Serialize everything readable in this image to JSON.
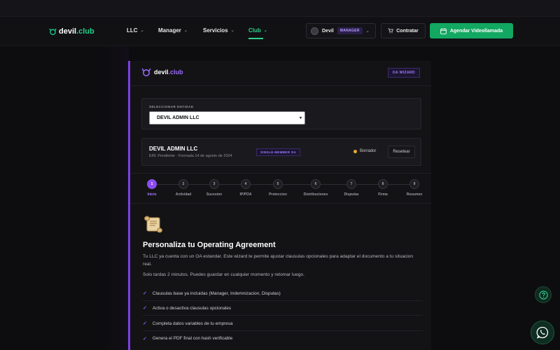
{
  "nav": {
    "logo_main": "devil",
    "logo_accent": ".club",
    "items": [
      {
        "label": "LLC"
      },
      {
        "label": "Manager"
      },
      {
        "label": "Servicios"
      },
      {
        "label": "Club",
        "active": true
      }
    ],
    "user": {
      "name": "Devil",
      "role": "MANAGER"
    },
    "contratar_label": "Contratar",
    "video_label": "Agendar Videollamada"
  },
  "panel": {
    "logo_main": "devil",
    "logo_accent": ".club",
    "badge": "OA WIZARD",
    "select_label": "SELECCIONAR ENTIDAD",
    "select_value": "DEVIL ADMIN LLC",
    "entity": {
      "name": "DEVIL ADMIN LLC",
      "sub": "EIN: Pendiente · Formada 14 de agosto de 2024",
      "badge": "SINGLE-MEMBER OA",
      "status": "Borrador",
      "reset_label": "Resetear"
    },
    "steps": [
      {
        "num": "1",
        "label": "Inicio"
      },
      {
        "num": "2",
        "label": "Actividad"
      },
      {
        "num": "3",
        "label": "Sucesion"
      },
      {
        "num": "4",
        "label": "IP/POA"
      },
      {
        "num": "5",
        "label": "Proteccion"
      },
      {
        "num": "6",
        "label": "Distribuciones"
      },
      {
        "num": "7",
        "label": "Disputas"
      },
      {
        "num": "8",
        "label": "Firma"
      },
      {
        "num": "9",
        "label": "Resumen"
      }
    ],
    "active_step": 1,
    "title": "Personaliza tu Operating Agreement",
    "paragraph1": "Tu LLC ya cuenta con un OA estandar. Este wizard te permite ajustar clausulas opcionales para adaptar el documento a tu situacion real.",
    "paragraph2": "Solo tardas 2 minutos. Puedes guardar en cualquier momento y retomar luego.",
    "checks": [
      "Clausulas base ya incluidas (Manager, Indemnizacion, Disputas)",
      "Activa o desactiva clausulas opcionales",
      "Completa datos variables de tu empresa",
      "Genera el PDF final con hash verificable"
    ]
  },
  "colors": {
    "accent_purple": "#8a4cf0",
    "accent_green": "#12a862",
    "status_draft": "#e8a92c"
  },
  "icons": [
    "devil-logo-icon",
    "chevron-down-icon",
    "cart-icon",
    "calendar-icon",
    "scroll-icon",
    "check-icon",
    "help-icon",
    "whatsapp-icon"
  ]
}
